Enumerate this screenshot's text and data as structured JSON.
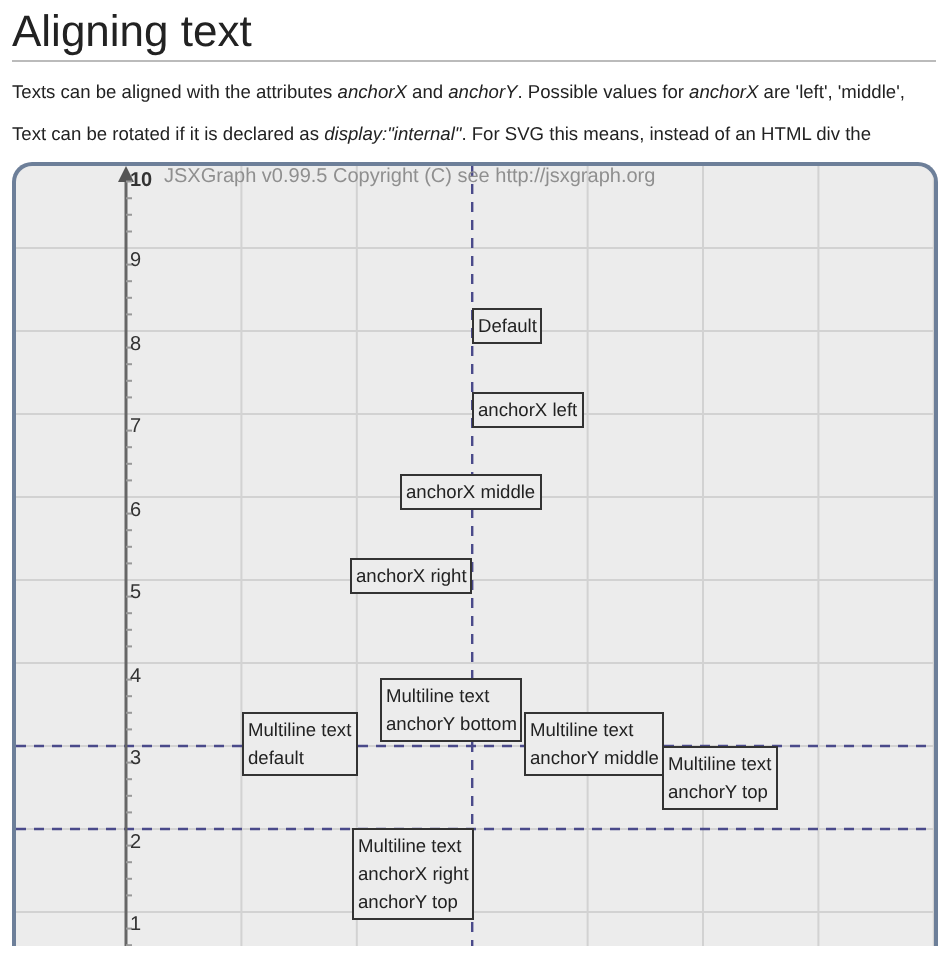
{
  "heading": "Aligning text",
  "paragraphs": [
    "Texts can be aligned with the attributes *anchorX* and *anchorY*. Possible values for *anchorX* are 'left', 'middle',",
    "Text can be rotated if it is declared as *display:\"internal\"*. For SVG this means, instead of an HTML div the"
  ],
  "board": {
    "copyright": "JSXGraph v0.99.5 Copyright (C) see http://jsxgraph.org",
    "y_ticks": [
      "10",
      "9",
      "8",
      "7",
      "6",
      "5",
      "4",
      "3",
      "2",
      "1"
    ],
    "texts": [
      {
        "lines": [
          "Default"
        ]
      },
      {
        "lines": [
          "anchorX left"
        ]
      },
      {
        "lines": [
          "anchorX middle"
        ]
      },
      {
        "lines": [
          "anchorX right"
        ]
      },
      {
        "lines": [
          "Multiline text",
          "default"
        ]
      },
      {
        "lines": [
          "Multiline text",
          "anchorY bottom"
        ]
      },
      {
        "lines": [
          "Multiline text",
          "anchorY middle"
        ]
      },
      {
        "lines": [
          "Multiline text",
          "anchorY top"
        ]
      },
      {
        "lines": [
          "Multiline text",
          "anchorX right",
          "anchorY top"
        ]
      }
    ]
  }
}
